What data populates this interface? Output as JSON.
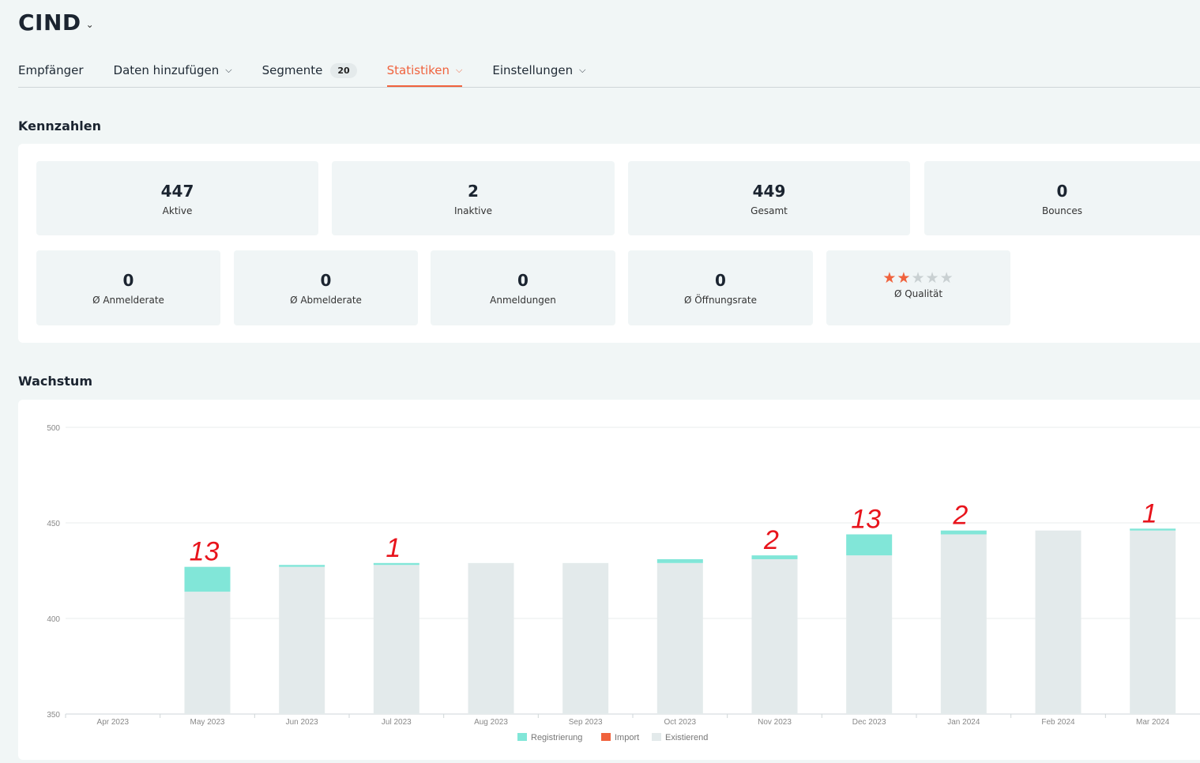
{
  "header": {
    "title": "CIND"
  },
  "nav": {
    "items": [
      {
        "label": "Empfänger"
      },
      {
        "label": "Daten hinzufügen"
      },
      {
        "label": "Segmente",
        "badge": "20"
      },
      {
        "label": "Statistiken"
      },
      {
        "label": "Einstellungen"
      }
    ]
  },
  "kennzahlen": {
    "title": "Kennzahlen",
    "row1": [
      {
        "value": "447",
        "label": "Aktive"
      },
      {
        "value": "2",
        "label": "Inaktive"
      },
      {
        "value": "449",
        "label": "Gesamt"
      },
      {
        "value": "0",
        "label": "Bounces"
      }
    ],
    "row2": [
      {
        "value": "0",
        "label": "Ø Anmelderate"
      },
      {
        "value": "0",
        "label": "Ø Abmelderate"
      },
      {
        "value": "0",
        "label": "Anmeldungen"
      },
      {
        "value": "0",
        "label": "Ø Öffnungsrate"
      }
    ],
    "quality": {
      "label": "Ø Qualität",
      "stars_filled": 2,
      "stars_total": 5
    }
  },
  "wachstum": {
    "title": "Wachstum"
  },
  "colors": {
    "accent": "#f0623d",
    "registrierung": "#81e6d8",
    "import": "#f0623d",
    "existierend": "#e3eaeb",
    "annotation": "#e8141c"
  },
  "chart_data": {
    "type": "bar",
    "stacked": true,
    "ylim": [
      350,
      500
    ],
    "yticks": [
      "350",
      "400",
      "450",
      "500"
    ],
    "categories": [
      "Apr 2023",
      "May 2023",
      "Jun 2023",
      "Jul 2023",
      "Aug 2023",
      "Sep 2023",
      "Oct 2023",
      "Nov 2023",
      "Dec 2023",
      "Jan 2024",
      "Feb 2024",
      "Mar 2024"
    ],
    "series": [
      {
        "name": "Existierend",
        "values": [
          null,
          414,
          427,
          428,
          429,
          429,
          429,
          431,
          433,
          444,
          446,
          446
        ]
      },
      {
        "name": "Registrierung",
        "values": [
          null,
          13,
          1,
          1,
          0,
          0,
          2,
          2,
          11,
          2,
          0,
          1
        ]
      },
      {
        "name": "Import",
        "values": [
          null,
          0,
          0,
          0,
          0,
          0,
          0,
          0,
          0,
          0,
          0,
          0
        ]
      }
    ],
    "annotations": [
      {
        "category": "May 2023",
        "text": "13"
      },
      {
        "category": "Jul 2023",
        "text": "1"
      },
      {
        "category": "Nov 2023",
        "text": "2"
      },
      {
        "category": "Dec 2023",
        "text": "13"
      },
      {
        "category": "Jan 2024",
        "text": "2"
      },
      {
        "category": "Mar 2024",
        "text": "1"
      }
    ],
    "legend_position": "bottom",
    "grid": true
  }
}
